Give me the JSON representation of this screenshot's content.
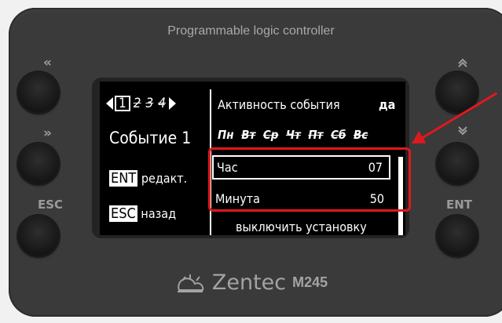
{
  "device": {
    "title": "Programmable logic controller",
    "brand": "Zentec",
    "model": "M245",
    "side_labels": {
      "top_left": "«",
      "mid_left": "»",
      "esc": "ESC",
      "top_right": "«",
      "mid_right": "»",
      "ent": "ENT"
    }
  },
  "screen": {
    "tabs": [
      "1",
      "2",
      "3",
      "4"
    ],
    "active_tab": "1",
    "event_title": "Событие 1",
    "ent_key": "ENT",
    "ent_action": "редакт.",
    "esc_key": "ESC",
    "esc_action": "назад",
    "activity_label": "Активность события",
    "activity_value": "да",
    "days": [
      "Пн",
      "Вт",
      "Ср",
      "Чт",
      "Пт",
      "Сб",
      "Вс"
    ],
    "fields": [
      {
        "label": "Час",
        "value": "07"
      },
      {
        "label": "Минута",
        "value": "50"
      }
    ],
    "bottom_action": "выключить установку"
  },
  "annotation": {
    "color": "#e0181e"
  }
}
